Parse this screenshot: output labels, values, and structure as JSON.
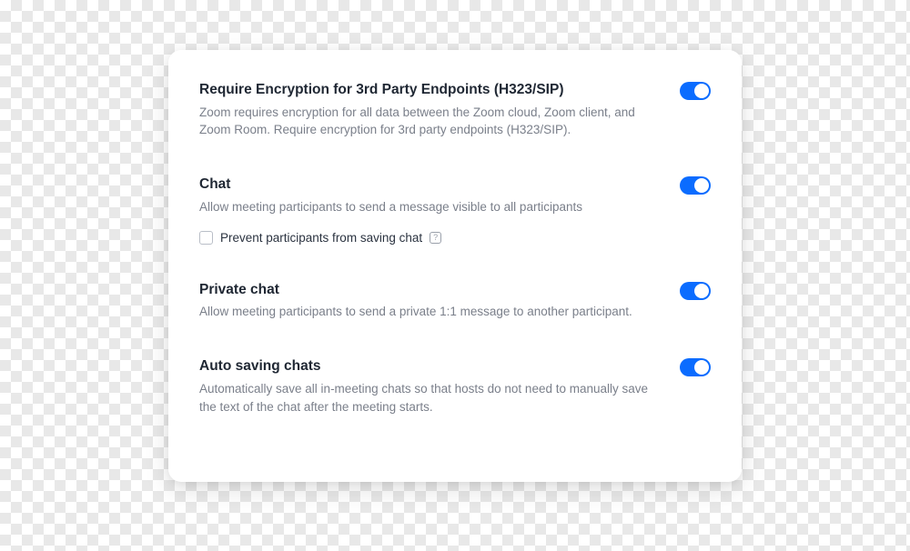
{
  "settings": {
    "encryption": {
      "title": "Require Encryption for 3rd Party Endpoints (H323/SIP)",
      "desc": "Zoom requires encryption for all data between the Zoom cloud, Zoom client, and Zoom Room. Require encryption for 3rd party endpoints (H323/SIP).",
      "enabled": true
    },
    "chat": {
      "title": "Chat",
      "desc": "Allow meeting participants to send a message visible to all participants",
      "enabled": true,
      "prevent_save_label": "Prevent participants from saving chat",
      "prevent_save_checked": false
    },
    "private_chat": {
      "title": "Private chat",
      "desc": "Allow meeting participants to send a private 1:1 message to another participant.",
      "enabled": true
    },
    "auto_save": {
      "title": "Auto saving chats",
      "desc": "Automatically save all in-meeting chats so that hosts do not need to manually save the text of the chat after the meeting starts.",
      "enabled": true
    }
  }
}
